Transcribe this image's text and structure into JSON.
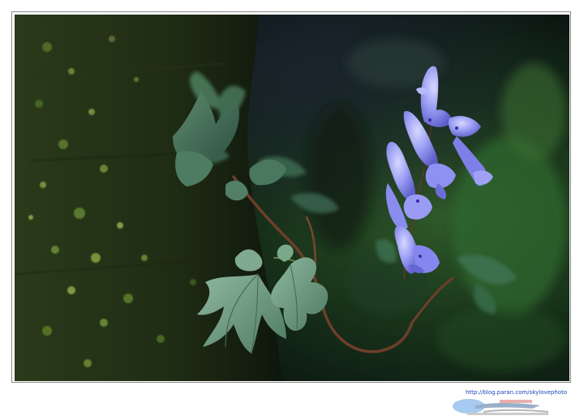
{
  "photo": {
    "subject": "corydalis flowers and leaves beside mossy rock",
    "colors": {
      "flower": "#8c8ef0",
      "leaf": "#6f9a84",
      "moss": "#3e5a22",
      "background": "#16301a"
    }
  },
  "watermark": {
    "url": "http://blog.paran.com/skylovephoto"
  }
}
